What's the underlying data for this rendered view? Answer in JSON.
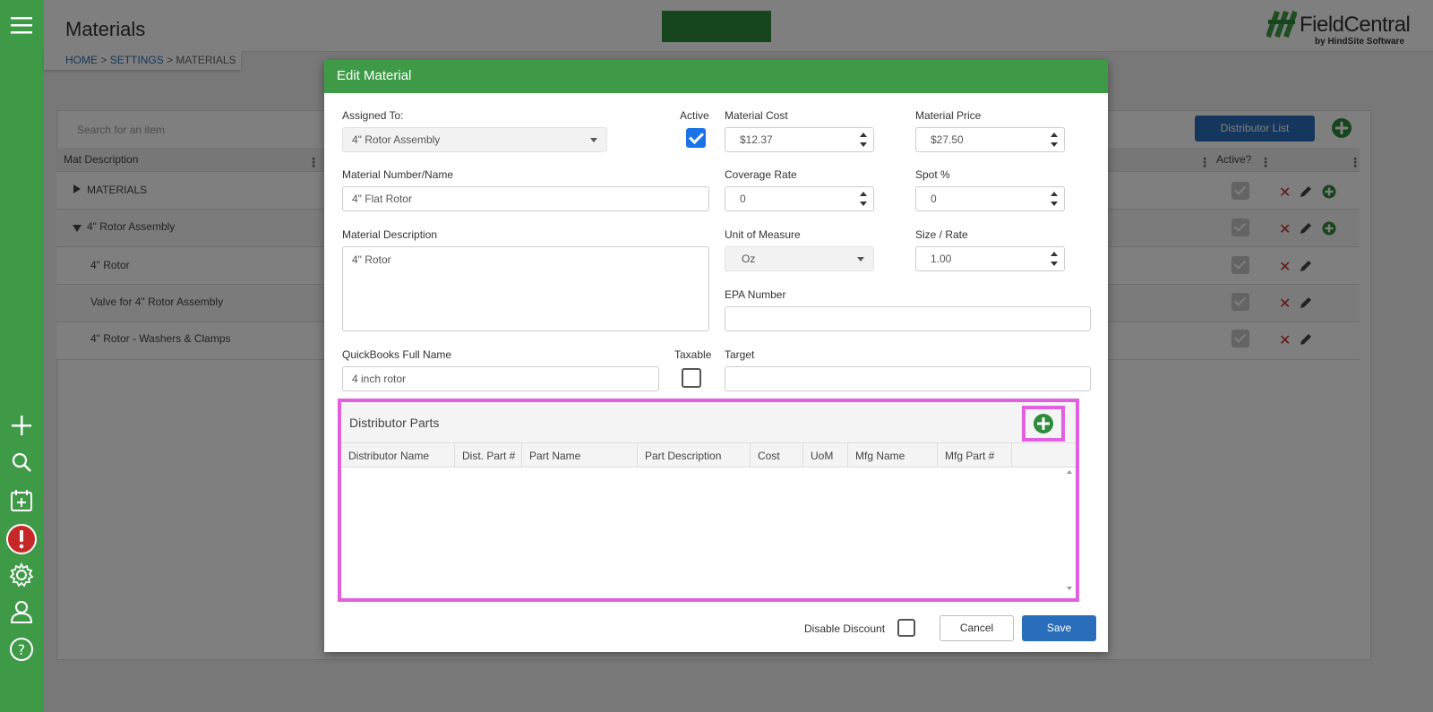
{
  "header": {
    "title": "Materials",
    "brand_name": "FieldCentral",
    "brand_sub": "by HindSite Software"
  },
  "breadcrumb": {
    "home": "HOME",
    "settings": "SETTINGS",
    "current": "MATERIALS",
    "sep": " > "
  },
  "background_grid": {
    "search_placeholder": "Search for an item",
    "distributor_list_label": "Distributor List",
    "col_desc": "Mat Description",
    "col_active": "Active?",
    "rows": [
      {
        "label": "MATERIALS"
      },
      {
        "label": "4\" Rotor Assembly"
      },
      {
        "label": "4\" Rotor"
      },
      {
        "label": "Valve for 4\" Rotor Assembly"
      },
      {
        "label": "4\" Rotor - Washers & Clamps"
      }
    ]
  },
  "modal": {
    "title": "Edit Material",
    "assigned_to": {
      "label": "Assigned To:",
      "value": "4\" Rotor Assembly"
    },
    "active_label": "Active",
    "material_cost": {
      "label": "Material Cost",
      "value": "$12.37"
    },
    "material_price": {
      "label": "Material Price",
      "value": "$27.50"
    },
    "material_number": {
      "label": "Material Number/Name",
      "value": "4\" Flat Rotor"
    },
    "coverage_rate": {
      "label": "Coverage Rate",
      "value": "0"
    },
    "spot_pct": {
      "label": "Spot %",
      "value": "0"
    },
    "material_description": {
      "label": "Material Description",
      "value": "4\" Rotor"
    },
    "unit_of_measure": {
      "label": "Unit of Measure",
      "value": "Oz"
    },
    "size_rate": {
      "label": "Size / Rate",
      "value": "1.00"
    },
    "epa_number": {
      "label": "EPA Number",
      "value": ""
    },
    "quickbooks_name": {
      "label": "QuickBooks Full Name",
      "value": "4 inch rotor"
    },
    "taxable_label": "Taxable",
    "target": {
      "label": "Target",
      "value": ""
    },
    "distributor_parts": {
      "title": "Distributor Parts",
      "columns": [
        "Distributor Name",
        "Dist. Part #",
        "Part Name",
        "Part Description",
        "Cost",
        "UoM",
        "Mfg Name",
        "Mfg Part #"
      ]
    },
    "disable_discount_label": "Disable Discount",
    "cancel_label": "Cancel",
    "save_label": "Save"
  },
  "colors": {
    "nav_green": "#3f9a48",
    "accent_blue": "#2a6ebb",
    "highlight": "#e060e0"
  }
}
